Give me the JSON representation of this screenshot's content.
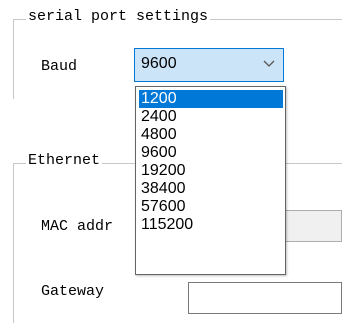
{
  "serial_settings": {
    "title": "serial port settings",
    "baud_label": "Baud",
    "baud_value": "9600",
    "baud_options": [
      "1200",
      "2400",
      "4800",
      "9600",
      "19200",
      "38400",
      "57600",
      "115200"
    ],
    "highlighted_option": "1200"
  },
  "ethernet_settings": {
    "title": "Ethernet",
    "mac_label": "MAC addr",
    "gateway_label": "Gateway"
  },
  "colors": {
    "selection_blue": "#0078d7",
    "combo_focus_bg": "#cce4f7",
    "groupbox_border": "#c8c8c8"
  }
}
